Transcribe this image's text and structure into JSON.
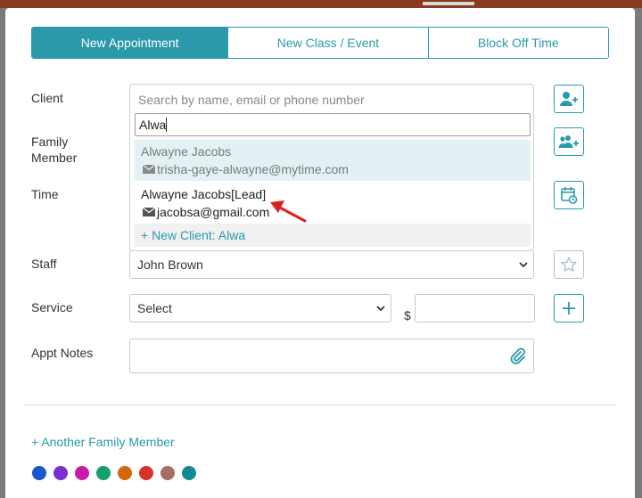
{
  "tabs": [
    {
      "label": "New Appointment",
      "active": true
    },
    {
      "label": "New Class / Event",
      "active": false
    },
    {
      "label": "Block Off Time",
      "active": false
    }
  ],
  "form": {
    "client_label": "Client",
    "family_label": "Family Member",
    "time_label": "Time",
    "staff_label": "Staff",
    "service_label": "Service",
    "notes_label": "Appt Notes"
  },
  "client": {
    "placeholder": "Search by name, email or phone number",
    "search_value": "Alwa",
    "results": [
      {
        "name": "Alwayne Jacobs",
        "email": "trisha-gaye-alwayne@mytime.com",
        "highlighted": true
      },
      {
        "name": "Alwayne Jacobs[Lead]",
        "email": "jacobsa@gmail.com",
        "highlighted": false
      }
    ],
    "new_client_label": "+ New Client: Alwa"
  },
  "staff": {
    "value": "John Brown"
  },
  "service": {
    "value": "Select",
    "currency": "$"
  },
  "another_member_label": "+ Another Family Member",
  "icons": {
    "add_client": "user-plus-icon",
    "add_family": "users-plus-icon",
    "calendar": "calendar-refresh-icon",
    "favorite": "star-icon",
    "add_service": "plus-icon",
    "attach": "paperclip-icon"
  },
  "colors": {
    "accent": "#2a9aab",
    "annotation_arrow": "#e02020",
    "swatches": [
      "#1a56cc",
      "#7a2ed0",
      "#cc1aa8",
      "#13a06b",
      "#d4670e",
      "#d8322c",
      "#a56f62",
      "#138a8f"
    ]
  }
}
